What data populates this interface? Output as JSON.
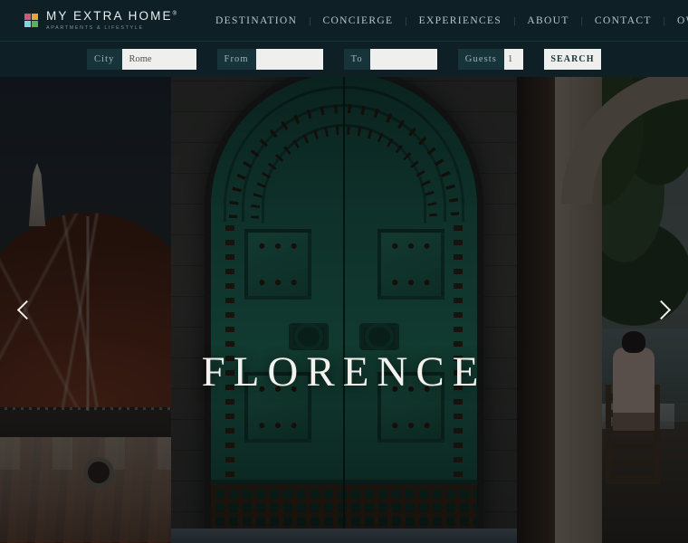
{
  "brand": {
    "name": "MY EXTRA HOME",
    "trademark": "®",
    "tagline": "APARTMENTS & LIFESTYLE",
    "mark_colors": [
      "#d4557a",
      "#e8a33d",
      "#7fd4e0",
      "#5fae5a"
    ]
  },
  "nav": {
    "separator": "|",
    "items": [
      {
        "label": "DESTINATION"
      },
      {
        "label": "CONCIERGE"
      },
      {
        "label": "EXPERIENCES"
      },
      {
        "label": "ABOUT"
      },
      {
        "label": "CONTACT"
      },
      {
        "label": "OWNERS"
      }
    ]
  },
  "search": {
    "city": {
      "label": "City",
      "value": "Rome",
      "placeholder": "Rome"
    },
    "from": {
      "label": "From",
      "value": "",
      "placeholder": ""
    },
    "to": {
      "label": "To",
      "value": "",
      "placeholder": ""
    },
    "guests": {
      "label": "Guests",
      "value": "1",
      "placeholder": "1"
    },
    "submit_label": "SEARCH"
  },
  "hero": {
    "title": "FLORENCE",
    "prev_label": "Previous slide",
    "next_label": "Next slide",
    "slides": [
      {
        "name": "florence-duomo",
        "alt": "Florence Duomo cathedral above terracotta rooftops"
      },
      {
        "name": "bronze-door",
        "alt": "Ornate green patinated bronze studded arched door"
      },
      {
        "name": "terrace-dining",
        "alt": "People dining outdoors on a shaded terrace under an arch"
      }
    ]
  },
  "colors": {
    "header_bg": "#0e2026",
    "label_bg": "#17343b",
    "input_bg": "#efefed",
    "nav_text": "#b6c6cb",
    "title_text": "#f4f2ee"
  }
}
